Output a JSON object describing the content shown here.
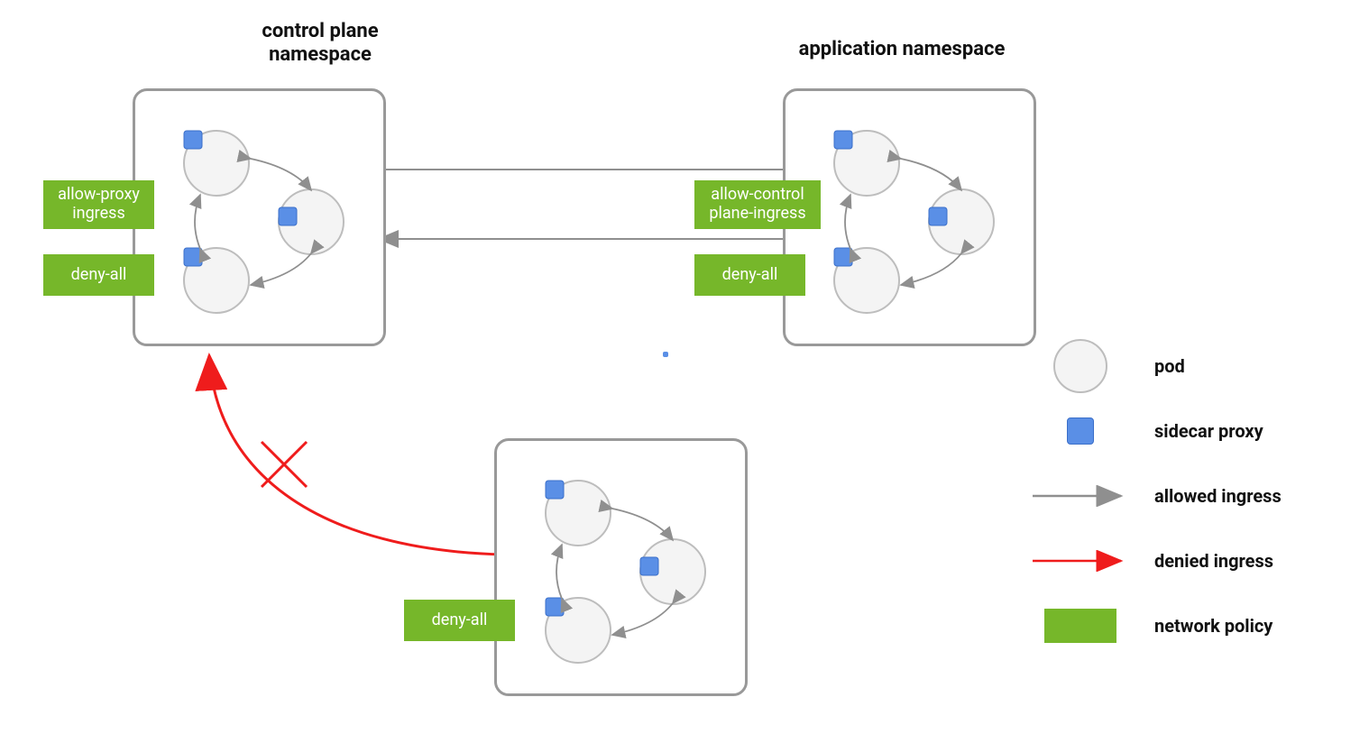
{
  "titles": {
    "control_plane": "control plane\nnamespace",
    "application": "application namespace"
  },
  "policies": {
    "cp_allow_proxy": "allow-proxy\ningress",
    "cp_deny_all": "deny-all",
    "app_allow_cp": "allow-control\nplane-ingress",
    "app_deny_all": "deny-all",
    "rogue_deny_all": "deny-all"
  },
  "legend": {
    "pod": "pod",
    "sidecar_proxy": "sidecar proxy",
    "allowed_ingress": "allowed ingress",
    "denied_ingress": "denied ingress",
    "network_policy": "network policy"
  },
  "colors": {
    "policy_green": "#76b72a",
    "proxy_blue": "#5a8fe6",
    "pod_fill": "#f4f4f4",
    "box_border": "#999999",
    "arrow_grey": "#8f8f8f",
    "arrow_red": "#ef1c1c"
  }
}
